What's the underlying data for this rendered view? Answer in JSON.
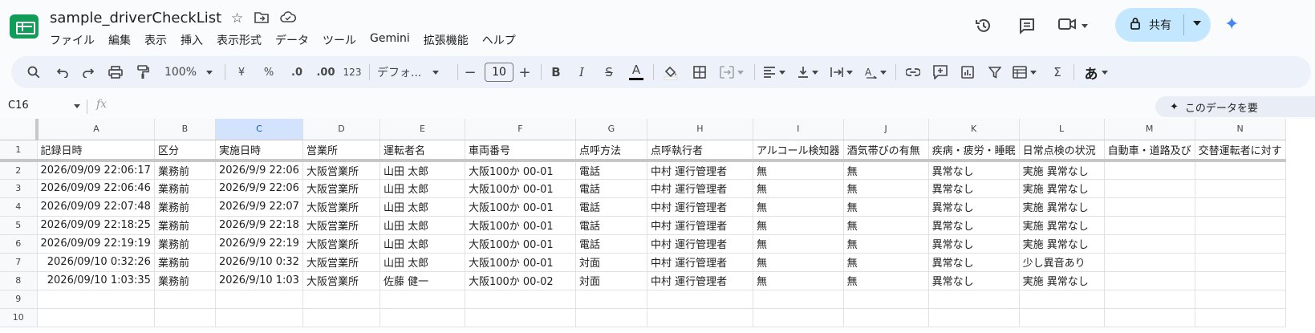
{
  "app": {
    "doc_title": "sample_driverCheckList",
    "menu": [
      "ファイル",
      "編集",
      "表示",
      "挿入",
      "表示形式",
      "データ",
      "ツール",
      "Gemini",
      "拡張機能",
      "ヘルプ"
    ],
    "share_label": "共有",
    "accent_color": "#c2e7ff",
    "brand_color": "#0f9d58"
  },
  "toolbar": {
    "zoom": "100%",
    "currency": "¥",
    "percent": "%",
    "dec_decrease": ".0",
    "dec_increase": ".00",
    "format_123": "123",
    "font": "デフォ...",
    "font_size": "10",
    "bold": "B",
    "italic": "I",
    "strike": "S",
    "text_color": "A",
    "sigma": "Σ",
    "input_tool": "あ"
  },
  "formula_bar": {
    "name_box": "C16",
    "fx": "fx",
    "explore_label": "このデータを要"
  },
  "grid": {
    "columns": [
      "A",
      "B",
      "C",
      "D",
      "E",
      "F",
      "G",
      "H",
      "I",
      "J",
      "K",
      "L",
      "M",
      "N"
    ],
    "selected_column": "C",
    "row_numbers": [
      "1",
      "2",
      "3",
      "4",
      "5",
      "6",
      "7",
      "8",
      "9",
      "10"
    ],
    "header_row": [
      "記録日時",
      "区分",
      "実施日時",
      "営業所",
      "運転者名",
      "車両番号",
      "点呼方法",
      "点呼執行者",
      "アルコール検知器",
      "酒気帯びの有無",
      "疾病・疲労・睡眠",
      "日常点検の状況",
      "自動車・道路及び",
      "交替運転者に対す"
    ],
    "rows": [
      [
        "2026/09/09 22:06:17",
        "業務前",
        "2026/9/9 22:06",
        "大阪営業所",
        "山田 太郎",
        "大阪100か 00-01",
        "電話",
        "中村 運行管理者",
        "無",
        "無",
        "異常なし",
        "実施 異常なし",
        "",
        ""
      ],
      [
        "2026/09/09 22:06:46",
        "業務前",
        "2026/9/9 22:06",
        "大阪営業所",
        "山田 太郎",
        "大阪100か 00-01",
        "電話",
        "中村 運行管理者",
        "無",
        "無",
        "異常なし",
        "実施 異常なし",
        "",
        ""
      ],
      [
        "2026/09/09 22:07:48",
        "業務前",
        "2026/9/9 22:07",
        "大阪営業所",
        "山田 太郎",
        "大阪100か 00-01",
        "電話",
        "中村 運行管理者",
        "無",
        "無",
        "異常なし",
        "実施 異常なし",
        "",
        ""
      ],
      [
        "2026/09/09 22:18:25",
        "業務前",
        "2026/9/9 22:18",
        "大阪営業所",
        "山田 太郎",
        "大阪100か 00-01",
        "電話",
        "中村 運行管理者",
        "無",
        "無",
        "異常なし",
        "実施 異常なし",
        "",
        ""
      ],
      [
        "2026/09/09 22:19:19",
        "業務前",
        "2026/9/9 22:19",
        "大阪営業所",
        "山田 太郎",
        "大阪100か 00-01",
        "電話",
        "中村 運行管理者",
        "無",
        "無",
        "異常なし",
        "実施 異常なし",
        "",
        ""
      ],
      [
        "2026/09/10 0:32:26",
        "業務前",
        "2026/9/10 0:32",
        "大阪営業所",
        "山田 太郎",
        "大阪100か 00-01",
        "対面",
        "中村 運行管理者",
        "無",
        "無",
        "異常なし",
        "少し異音あり",
        "",
        ""
      ],
      [
        "2026/09/10 1:03:35",
        "業務前",
        "2026/9/10 1:03",
        "大阪営業所",
        "佐藤 健一",
        "大阪100か 00-02",
        "対面",
        "中村 運行管理者",
        "無",
        "無",
        "異常なし",
        "実施 異常なし",
        "",
        ""
      ],
      [
        "",
        "",
        "",
        "",
        "",
        "",
        "",
        "",
        "",
        "",
        "",
        "",
        "",
        ""
      ],
      [
        "",
        "",
        "",
        "",
        "",
        "",
        "",
        "",
        "",
        "",
        "",
        "",
        "",
        ""
      ]
    ]
  }
}
